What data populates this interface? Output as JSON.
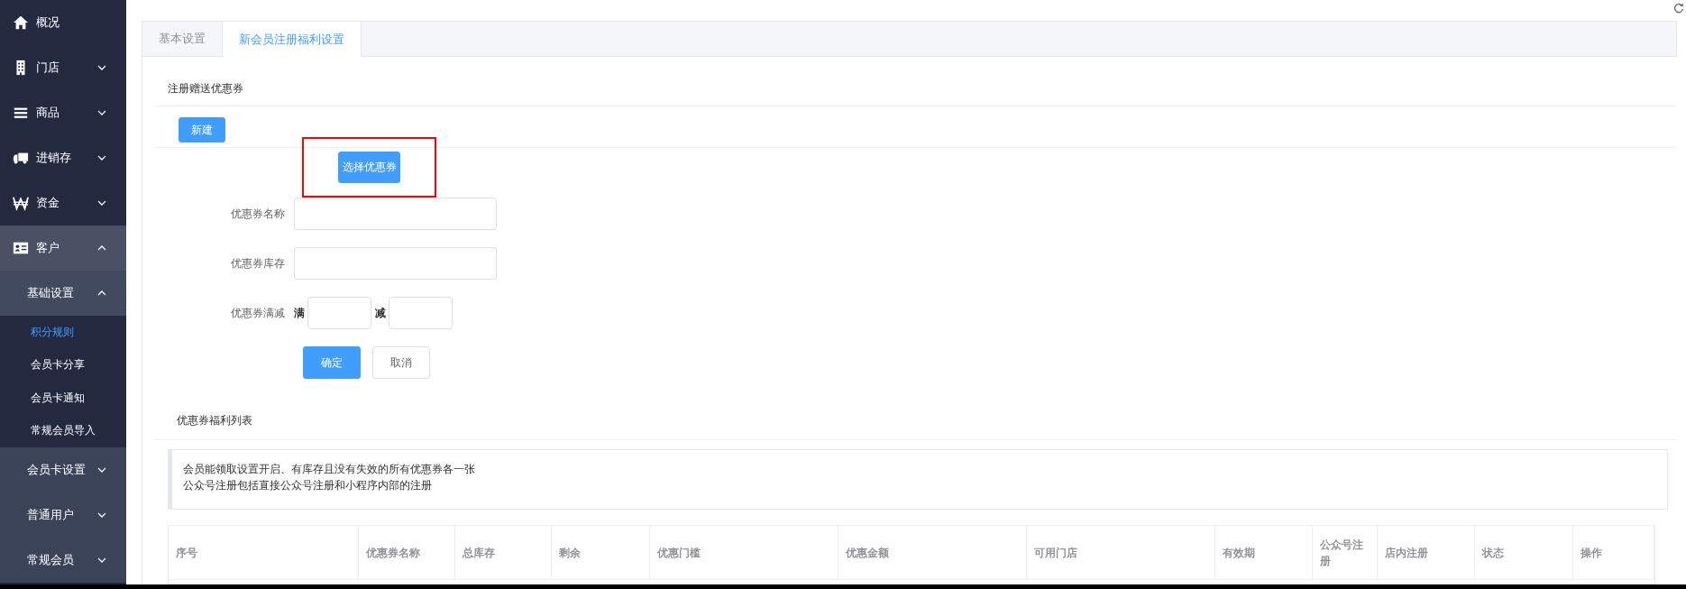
{
  "sidebar": {
    "items": [
      {
        "label": "概况",
        "kind": "link",
        "selected": false
      },
      {
        "label": "门店",
        "kind": "group",
        "expanded": false
      },
      {
        "label": "商品",
        "kind": "group",
        "expanded": false
      },
      {
        "label": "进销存",
        "kind": "group",
        "expanded": false
      },
      {
        "label": "资金",
        "kind": "group",
        "expanded": false
      },
      {
        "label": "客户",
        "kind": "group",
        "expanded": true,
        "children": [
          {
            "label": "基础设置",
            "kind": "group",
            "expanded": true,
            "children": [
              {
                "label": "积分规则",
                "kind": "link",
                "selected": true
              },
              {
                "label": "会员卡分享",
                "kind": "link",
                "selected": false
              },
              {
                "label": "会员卡通知",
                "kind": "link",
                "selected": false
              },
              {
                "label": "常规会员导入",
                "kind": "link",
                "selected": false
              }
            ]
          },
          {
            "label": "会员卡设置",
            "kind": "group",
            "expanded": false
          },
          {
            "label": "普通用户",
            "kind": "group",
            "expanded": false
          },
          {
            "label": "常规会员",
            "kind": "group",
            "expanded": false
          }
        ]
      }
    ]
  },
  "tabs": [
    {
      "label": "基本设置",
      "selected": false
    },
    {
      "label": "新会员注册福利设置",
      "selected": true
    }
  ],
  "coupon_section": {
    "title": "注册赠送优惠券",
    "new_button": "新建",
    "select_button": {
      "label": "选择优惠券",
      "highlighted": true
    },
    "fields": [
      {
        "label": "优惠券名称",
        "kind": "text"
      },
      {
        "label": "优惠券库存",
        "kind": "text"
      },
      {
        "label": "优惠券满减",
        "kind": "range",
        "prefix": "满",
        "infix": "减"
      }
    ],
    "confirm_button": "确定",
    "cancel_button": "取消"
  },
  "list_section": {
    "title": "优惠券福利列表",
    "notice": [
      "会员能领取设置开启、有库存且没有失效的所有优惠券各一张",
      "公众号注册包括直接公众号注册和小程序内部的注册"
    ],
    "table": {
      "columns": [
        "序号",
        "优惠券名称",
        "总库存",
        "剩余",
        "优惠门槛",
        "优惠金额",
        "可用门店",
        "有效期",
        "公众号注册",
        "店内注册",
        "状态",
        "操作"
      ]
    }
  }
}
